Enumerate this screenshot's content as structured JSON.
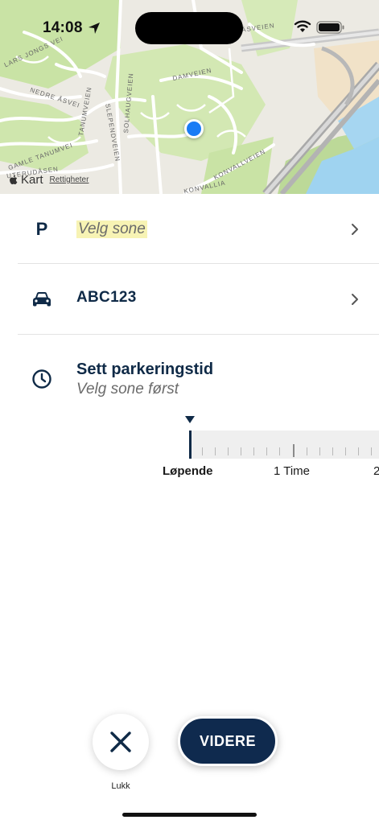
{
  "status": {
    "time": "14:08",
    "location_icon": "location-arrow-icon",
    "wifi_icon": "wifi-icon",
    "battery_icon": "battery-icon"
  },
  "map": {
    "streets": [
      "DAMVEIEN",
      "SOLHAUGVEIEN",
      "SLEPENDVEIEN",
      "TANUMVEIEN",
      "NEDRE ÅSVEI",
      "KONVALLVEIEN",
      "KONVALLIA",
      "GAMLE TANUMVEI",
      "UTERUDÅSEN",
      "LARS JONGS VEI",
      "ÅSVEIEN"
    ],
    "brand": "Kart",
    "legal": "Rettigheter",
    "colors": {
      "park": "#c9e3a5",
      "water": "#9fd3f0",
      "road": "#ffffff",
      "highway": "#a9a9a9",
      "user_dot": "#1a7cf5"
    }
  },
  "zone_row": {
    "icon": "parking-icon",
    "icon_glyph": "P",
    "label": "Velg sone"
  },
  "vehicle_row": {
    "icon": "car-icon",
    "label": "ABC123"
  },
  "time_row": {
    "icon": "clock-icon",
    "title": "Sett parkeringstid",
    "subtitle": "Velg sone først"
  },
  "ruler": {
    "labels": [
      "Løpende",
      "1 Time",
      "2"
    ]
  },
  "actions": {
    "close_label": "Lukk",
    "continue_label": "VIDERE"
  },
  "colors": {
    "navy": "#0f2a47",
    "highlight": "#f7f3b4",
    "ruler_bg": "#efefef"
  }
}
